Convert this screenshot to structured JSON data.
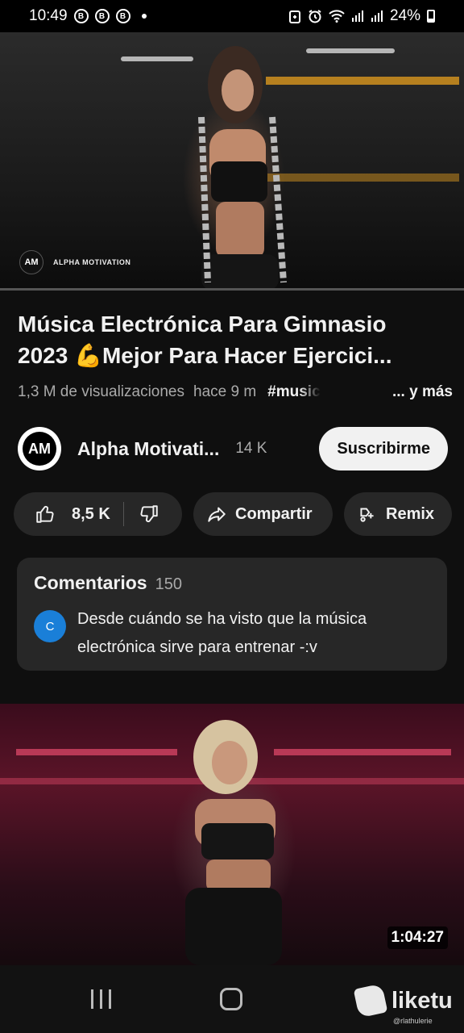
{
  "status_bar": {
    "time": "10:49",
    "notification_icons": [
      "b-circle-icon",
      "b-app-icon",
      "b-app-icon-2"
    ],
    "right_icons": [
      "battery-saver-icon",
      "alarm-icon",
      "wifi-icon",
      "signal-icon",
      "signal-icon-2"
    ],
    "battery": "24%"
  },
  "player": {
    "watermark": "ALPHA MOTIVATION",
    "watermark_logo": "AM",
    "progress_fraction": 0
  },
  "video": {
    "title_line1": "Música Electrónica Para Gimnasio",
    "title_line2_prefix": "2023 ",
    "title_emoji": "💪",
    "title_line2_rest": "Mejor Para Hacer Ejercici...",
    "views": "1,3 M de visualizaciones",
    "ago": "hace 9 m",
    "hashtag": "#music",
    "more": "... y más"
  },
  "channel": {
    "avatar_letters": "AM",
    "name": "Alpha Motivati...",
    "subscribers": "14 K",
    "subscribe_label": "Suscribirme"
  },
  "actions": {
    "likes": "8,5 K",
    "share": "Compartir",
    "remix": "Remix"
  },
  "comments": {
    "title": "Comentarios",
    "count": "150",
    "avatar_letter": "C",
    "top_comment": "Desde cuándo se ha visto que la música electrónica sirve para entrenar -:v"
  },
  "next_video": {
    "duration": "1:04:27"
  },
  "overlay": {
    "brand": "liketu",
    "handle": "@rlathulerie"
  },
  "colors": {
    "background": "#0f0f0f",
    "chip": "#272727",
    "subscribe_bg": "#f1f1f1",
    "progress": "#ff0000",
    "comment_avatar": "#1a7fd8"
  }
}
